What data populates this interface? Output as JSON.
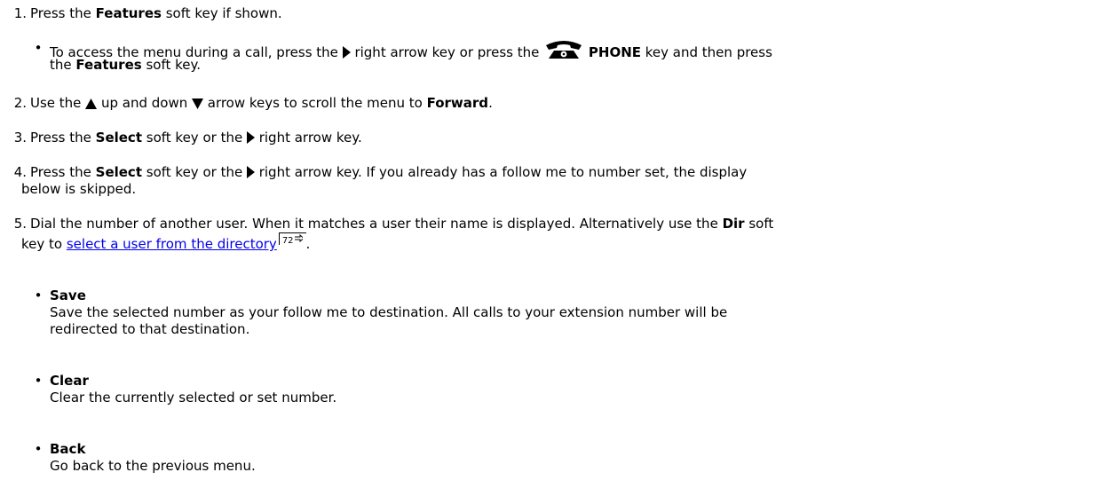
{
  "steps": [
    {
      "num": "1.",
      "a": "Press the ",
      "b": "Features",
      "c": " soft key if shown."
    },
    {
      "num": "2.",
      "a": "Use the ",
      "b": " up and down ",
      "c": " arrow keys to scroll the menu to ",
      "d": "Forward",
      "e": "."
    },
    {
      "num": "3.",
      "a": "Press the ",
      "b": "Select",
      "c": " soft key or the ",
      "d": " right arrow key."
    },
    {
      "num": "4.",
      "a": "Press the ",
      "b": "Select",
      "c": " soft key or the ",
      "d": " right arrow key. If you already has a follow me to number set, the display",
      "e": "below is skipped."
    },
    {
      "num": "5.",
      "a": "Dial the number of another user. When it matches a user their name is displayed. Alternatively use the ",
      "b": "Dir",
      "c": " soft",
      "d": "key to ",
      "link": "select a user from the directory",
      "ref": "72",
      "e": "."
    }
  ],
  "step1_bullet": {
    "a": "To access the menu during a call, press the ",
    "b": " right arrow key or press the ",
    "c": "PHONE",
    "d": " key and then press",
    "e": "the ",
    "f": "Features",
    "g": " soft key."
  },
  "options": [
    {
      "title": "Save",
      "desc1": "Save the selected number as your follow me to destination. All calls to your extension number will be",
      "desc2": "redirected to that destination."
    },
    {
      "title": "Clear",
      "desc1": "Clear the currently selected or set number."
    },
    {
      "title": "Back",
      "desc1": "Go back to the previous menu."
    }
  ],
  "icons": {
    "right_arrow": "right-arrow-key-icon",
    "up_arrow": "up-arrow-key-icon",
    "down_arrow": "down-arrow-key-icon",
    "phone": "phone-key-icon",
    "xref_arrow": "cross-reference-arrow-icon"
  }
}
